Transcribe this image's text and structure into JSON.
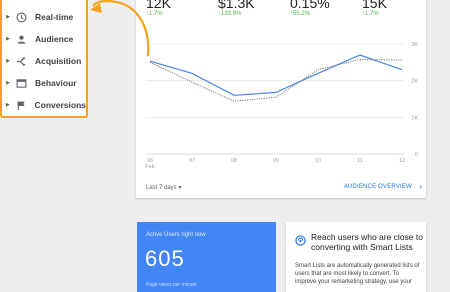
{
  "metrics": [
    {
      "value": "12K",
      "change": "↑1.7%"
    },
    {
      "value": "$1.3K",
      "change": "↑133.9%"
    },
    {
      "value": "0.15%",
      "change": "↑55.2%"
    },
    {
      "value": "15K",
      "change": "↑1.7%"
    }
  ],
  "sidebar": {
    "items": [
      {
        "label": "Real-time",
        "icon": "clock-icon"
      },
      {
        "label": "Audience",
        "icon": "person-icon"
      },
      {
        "label": "Acquisition",
        "icon": "acquisition-icon"
      },
      {
        "label": "Behaviour",
        "icon": "behaviour-icon"
      },
      {
        "label": "Conversions",
        "icon": "flag-icon"
      }
    ]
  },
  "chart_data": {
    "type": "line",
    "x": [
      "06 Feb",
      "07",
      "08",
      "09",
      "10",
      "11",
      "12"
    ],
    "x_tick_labels": [
      [
        "06",
        "Feb"
      ],
      [
        "07"
      ],
      [
        "08"
      ],
      [
        "09"
      ],
      [
        "10"
      ],
      [
        "11"
      ],
      [
        "12"
      ]
    ],
    "y_tick_labels": [
      "3K",
      "2K",
      "1K",
      "0"
    ],
    "ylim": [
      0,
      3000
    ],
    "grid": true,
    "series": [
      {
        "style": "solid",
        "color": "#4a86e8",
        "values": [
          2530,
          2200,
          1600,
          1680,
          2200,
          2700,
          2300
        ]
      },
      {
        "style": "dotted",
        "color": "#757575",
        "values": [
          2500,
          1960,
          1440,
          1550,
          2300,
          2580,
          2560
        ]
      }
    ]
  },
  "footer": {
    "date_range": "Last 7 days ▾",
    "overview_link": "AUDIENCE OVERVIEW"
  },
  "active_users": {
    "title": "Active Users right now",
    "count": "605",
    "footer": "Page views per minute"
  },
  "smart_lists": {
    "title": "Reach users who are close to converting with Smart Lists",
    "body": "Smart Lists are automatically generated lists of users that are most likely to convert. To improve your remarketing strategy, use your"
  },
  "colors": {
    "highlight": "#f6a21e",
    "accent": "#1a73e8",
    "active_card": "#4285f4",
    "positive": "#4caf50"
  }
}
